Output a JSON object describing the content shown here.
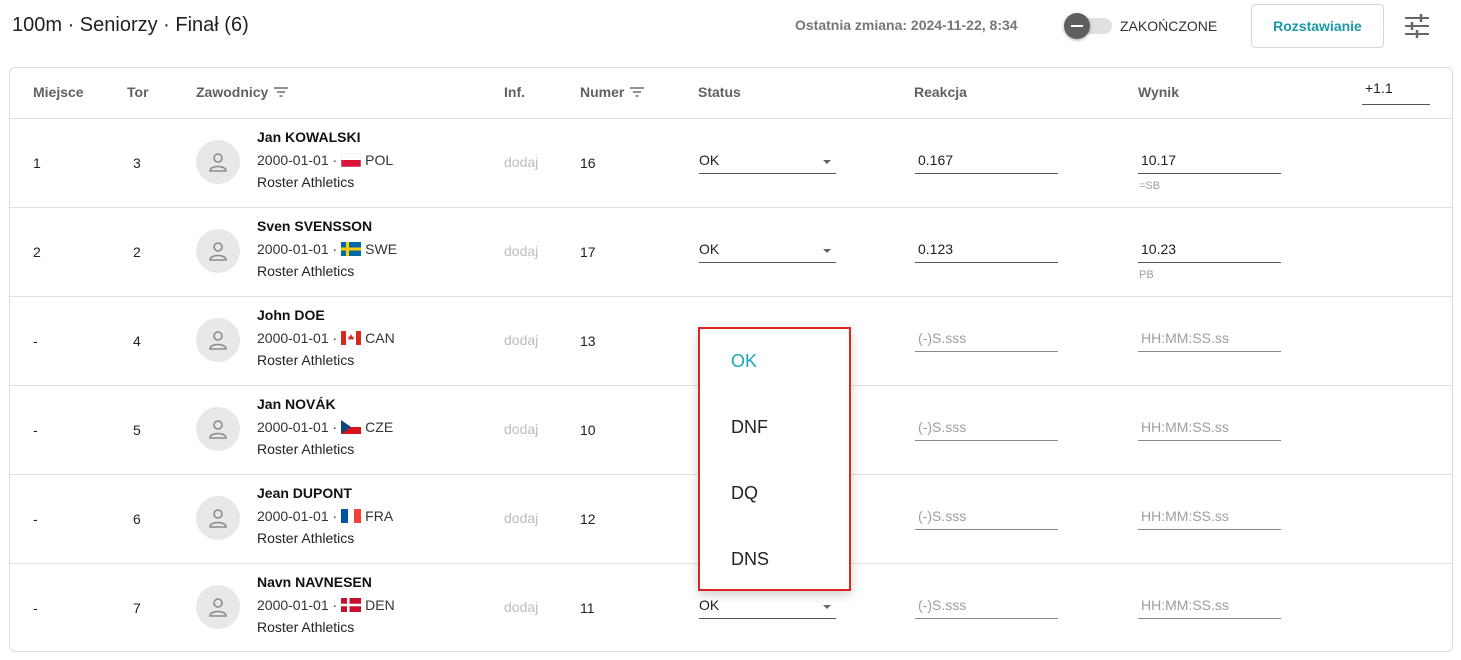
{
  "header": {
    "title": "100m · Seniorzy · Finał (6)",
    "last_change": "Ostatnia zmiana: 2024-11-22, 8:34",
    "toggle_label": "ZAKOŃCZONE",
    "seed_button": "Rozstawianie",
    "settings_icon": "tune-icon"
  },
  "table": {
    "columns": {
      "place": "Miejsce",
      "lane": "Tor",
      "athletes": "Zawodnicy",
      "info": "Inf.",
      "number": "Numer",
      "status": "Status",
      "reaction": "Reakcja",
      "result": "Wynik"
    },
    "wind": "+1.1",
    "info_link": "dodaj",
    "reaction_placeholder": "(-)S.sss",
    "result_placeholder": "HH:MM:SS.ss",
    "rows": [
      {
        "place": "1",
        "lane": "3",
        "name": "Jan KOWALSKI",
        "dob": "2000-01-01 ·",
        "country": "POL",
        "club": "Roster Athletics",
        "number": "16",
        "status": "OK",
        "reaction": "0.167",
        "result": "10.17",
        "note": "=SB"
      },
      {
        "place": "2",
        "lane": "2",
        "name": "Sven SVENSSON",
        "dob": "2000-01-01 ·",
        "country": "SWE",
        "club": "Roster Athletics",
        "number": "17",
        "status": "OK",
        "reaction": "0.123",
        "result": "10.23",
        "note": "PB"
      },
      {
        "place": "-",
        "lane": "4",
        "name": "John DOE",
        "dob": "2000-01-01 ·",
        "country": "CAN",
        "club": "Roster Athletics",
        "number": "13"
      },
      {
        "place": "-",
        "lane": "5",
        "name": "Jan NOVÁK",
        "dob": "2000-01-01 ·",
        "country": "CZE",
        "club": "Roster Athletics",
        "number": "10"
      },
      {
        "place": "-",
        "lane": "6",
        "name": "Jean DUPONT",
        "dob": "2000-01-01 ·",
        "country": "FRA",
        "club": "Roster Athletics",
        "number": "12"
      },
      {
        "place": "-",
        "lane": "7",
        "name": "Navn NAVNESEN",
        "dob": "2000-01-01 ·",
        "country": "DEN",
        "club": "Roster Athletics",
        "number": "11",
        "status": "OK"
      }
    ]
  },
  "status_dropdown": {
    "options": [
      "OK",
      "DNF",
      "DQ",
      "DNS"
    ],
    "selected": "OK"
  },
  "colors": {
    "accent": "#1a9aa8",
    "dropdown_border": "#e02424"
  }
}
